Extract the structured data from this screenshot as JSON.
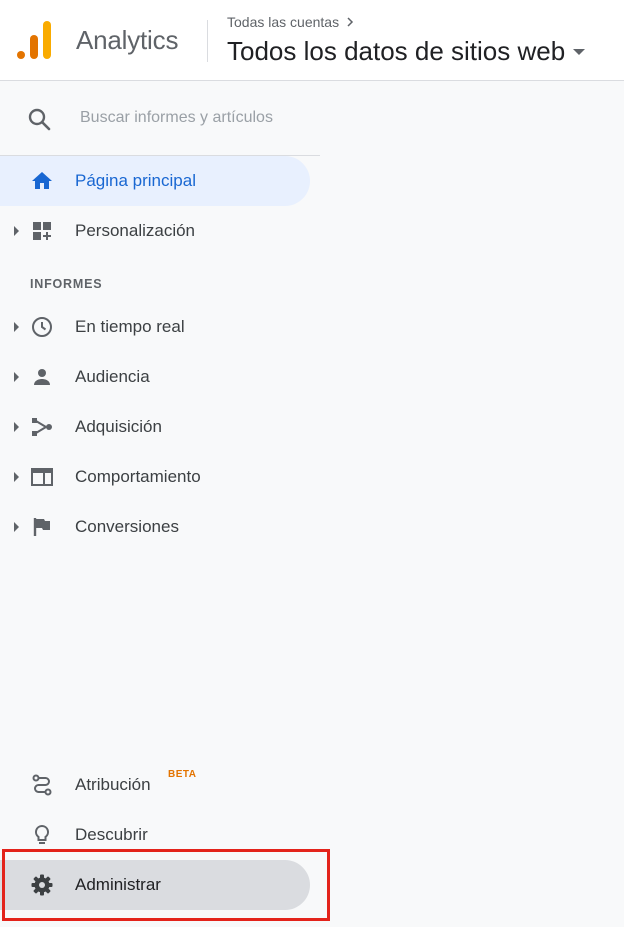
{
  "header": {
    "app_name": "Analytics",
    "breadcrumb": "Todas las cuentas",
    "property": "Todos los datos de sitios web"
  },
  "search": {
    "placeholder": "Buscar informes y artículos",
    "value": ""
  },
  "nav": {
    "home": "Página principal",
    "customization": "Personalización",
    "reports_title": "INFORMES",
    "realtime": "En tiempo real",
    "audience": "Audiencia",
    "acquisition": "Adquisición",
    "behavior": "Comportamiento",
    "conversions": "Conversiones",
    "attribution": "Atribución",
    "attribution_badge": "BETA",
    "discover": "Descubrir",
    "admin": "Administrar"
  },
  "colors": {
    "accent": "#1967d2",
    "active_bg": "#e8f0fe",
    "highlight_border": "#e3231b",
    "logo_dark": "#e37400",
    "logo_light": "#f9ab00"
  }
}
